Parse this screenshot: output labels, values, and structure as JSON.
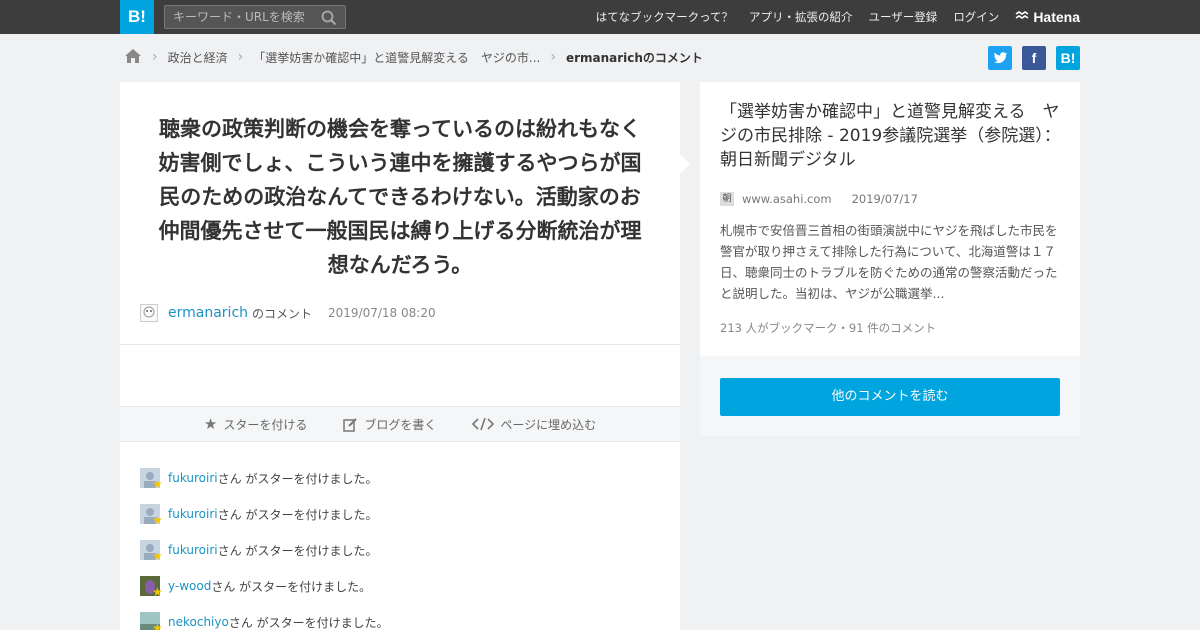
{
  "header": {
    "logo": "B!",
    "search_placeholder": "キーワード・URLを検索",
    "nav": [
      "はてなブックマークって？",
      "アプリ・拡張の紹介",
      "ユーザー登録",
      "ログイン"
    ],
    "brand": "Hatena"
  },
  "breadcrumb": {
    "items": [
      "政治と経済",
      "「選挙妨害か確認中」と道警見解変える　ヤジの市...",
      "ermanarichのコメント"
    ]
  },
  "share": {
    "twitter": "t",
    "facebook": "f",
    "hatena": "B!"
  },
  "comment": {
    "text": "聴衆の政策判断の機会を奪っているのは紛れもなく妨害側でしょ、こういう連中を擁護するやつらが国民のための政治なんてできるわけない。活動家のお仲間優先させて一般国民は縛り上げる分断統治が理想なんだろう。",
    "user": "ermanarich",
    "suffix": "のコメント",
    "date": "2019/07/18 08:20"
  },
  "actions": {
    "star": "スターを付ける",
    "blog": "ブログを書く",
    "embed": "ページに埋め込む"
  },
  "stars": [
    {
      "name": "fukuroiri",
      "text": "さん がスターを付けました。"
    },
    {
      "name": "fukuroiri",
      "text": "さん がスターを付けました。"
    },
    {
      "name": "fukuroiri",
      "text": "さん がスターを付けました。"
    },
    {
      "name": "y-wood",
      "text": "さん がスターを付けました。"
    },
    {
      "name": "nekochiyo",
      "text": "さん がスターを付けました。"
    }
  ],
  "article": {
    "title": "「選挙妨害か確認中」と道警見解変える　ヤジの市民排除 - 2019参議院選挙（参院選）：朝日新聞デジタル",
    "favicon": "朝",
    "domain": "www.asahi.com",
    "date": "2019/07/17",
    "description": "札幌市で安倍晋三首相の街頭演説中にヤジを飛ばした市民を警官が取り押さえて排除した行為について、北海道警は１７日、聴衆同士のトラブルを防ぐための通常の警察活動だったと説明した。当初は、ヤジが公職選挙...",
    "stats": "213 人がブックマーク・91 件のコメント",
    "read_more": "他のコメントを読む"
  }
}
